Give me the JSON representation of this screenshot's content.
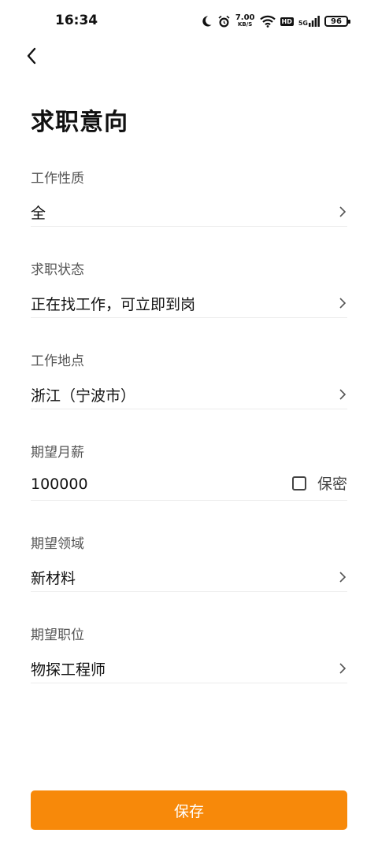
{
  "status_bar": {
    "time": "16:34",
    "net_speed_value": "7.00",
    "net_speed_unit": "KB/S",
    "hd_badge": "HD",
    "network": "5G",
    "battery": "96"
  },
  "page": {
    "title": "求职意向"
  },
  "fields": {
    "work_type": {
      "label": "工作性质",
      "value": "全"
    },
    "job_status": {
      "label": "求职状态",
      "value": "正在找工作，可立即到岗"
    },
    "location": {
      "label": "工作地点",
      "value": "浙江（宁波市）"
    },
    "salary": {
      "label": "期望月薪",
      "value": "100000",
      "secret_label": "保密"
    },
    "industry": {
      "label": "期望领域",
      "value": "新材料"
    },
    "position": {
      "label": "期望职位",
      "value": "物探工程师"
    }
  },
  "actions": {
    "save_label": "保存"
  },
  "colors": {
    "accent": "#f7890a"
  }
}
